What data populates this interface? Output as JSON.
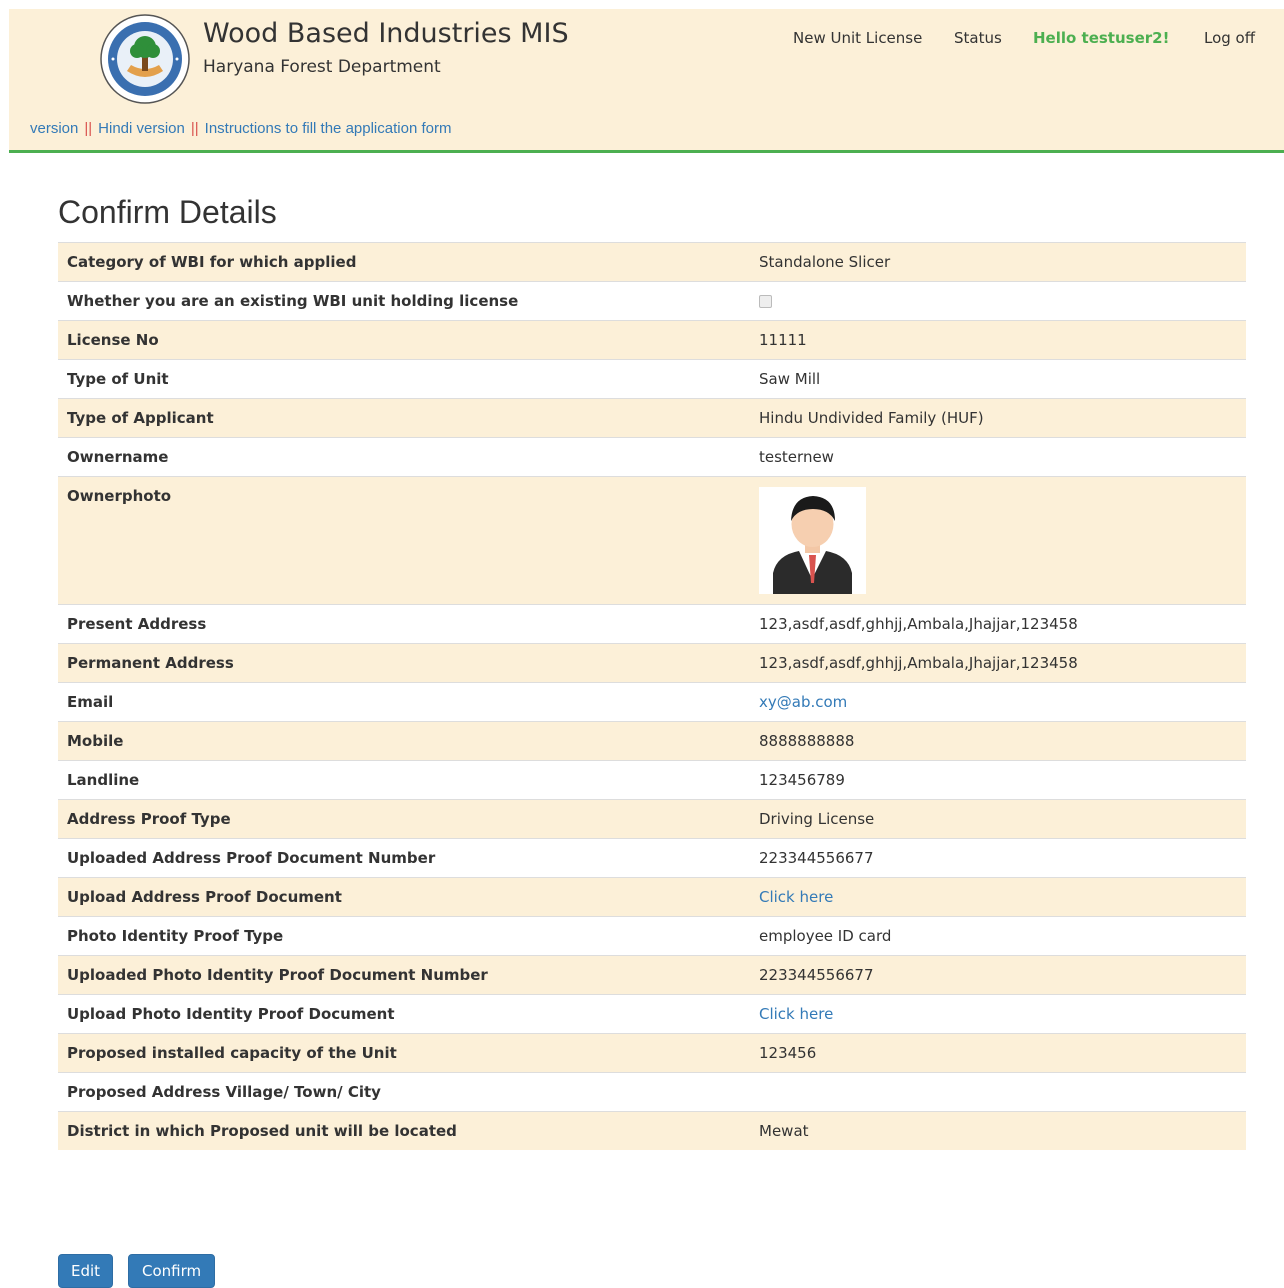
{
  "header": {
    "title": "Wood Based Industries MIS",
    "subtitle": "Haryana Forest Department",
    "nav": {
      "new_unit_license": "New Unit License",
      "status": "Status",
      "hello": "Hello testuser2!",
      "logoff": "Log off"
    },
    "links": {
      "version": "version",
      "separator": "||",
      "hindi": "Hindi version",
      "instructions": "Instructions to fill the application form"
    }
  },
  "main": {
    "title": "Confirm Details",
    "rows": [
      {
        "label": "Category of WBI for which applied",
        "value": "Standalone Slicer"
      },
      {
        "label": "Whether you are an existing WBI unit holding license",
        "value": ""
      },
      {
        "label": "License No",
        "value": "11111"
      },
      {
        "label": "Type of Unit",
        "value": "Saw Mill"
      },
      {
        "label": "Type of Applicant",
        "value": "Hindu Undivided Family (HUF)"
      },
      {
        "label": "Ownername",
        "value": "testernew"
      },
      {
        "label": "Ownerphoto",
        "value": ""
      },
      {
        "label": "Present Address",
        "value": "123,asdf,asdf,ghhjj,Ambala,Jhajjar,123458"
      },
      {
        "label": "Permanent Address",
        "value": "123,asdf,asdf,ghhjj,Ambala,Jhajjar,123458"
      },
      {
        "label": "Email",
        "value": "xy@ab.com"
      },
      {
        "label": "Mobile",
        "value": "8888888888"
      },
      {
        "label": "Landline",
        "value": "123456789"
      },
      {
        "label": "Address Proof Type",
        "value": "Driving License"
      },
      {
        "label": "Uploaded Address Proof Document Number",
        "value": "223344556677"
      },
      {
        "label": "Upload Address Proof Document",
        "value": "Click here"
      },
      {
        "label": "Photo Identity Proof Type",
        "value": "employee ID card"
      },
      {
        "label": "Uploaded Photo Identity Proof Document Number",
        "value": "223344556677"
      },
      {
        "label": "Upload Photo Identity Proof Document",
        "value": "Click here"
      },
      {
        "label": "Proposed installed capacity of the Unit",
        "value": "123456"
      },
      {
        "label": "Proposed Address Village/ Town/ City",
        "value": ""
      },
      {
        "label": "District in which Proposed unit will be located",
        "value": "Mewat"
      }
    ]
  },
  "buttons": {
    "edit": "Edit",
    "confirm": "Confirm"
  }
}
